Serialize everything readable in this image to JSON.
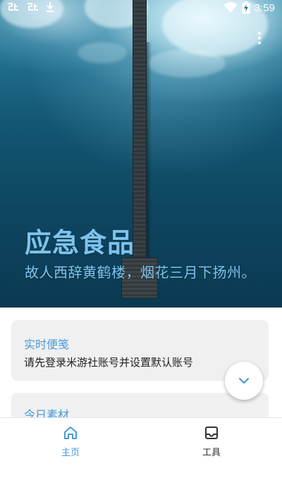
{
  "status_bar": {
    "time": "3:59",
    "left_icons": [
      "bug-icon",
      "bug-icon",
      "download-icon"
    ],
    "right_icons": [
      "wifi-icon",
      "battery-charging-icon"
    ]
  },
  "hero": {
    "title": "应急食品",
    "subtitle": "故人西辞黄鹤楼，烟花三月下扬州。",
    "text_color": "#7ec3ec"
  },
  "cards": [
    {
      "title": "实时便笺",
      "text": "请先登录米游社账号并设置默认账号"
    },
    {
      "title": "今日素材"
    }
  ],
  "bottom_nav": {
    "items": [
      {
        "label": "主页",
        "icon": "home-icon",
        "active": true
      },
      {
        "label": "工具",
        "icon": "inbox-icon",
        "active": false
      }
    ]
  },
  "colors": {
    "accent": "#4b9ad4",
    "card_bg": "#f0f0f0"
  }
}
